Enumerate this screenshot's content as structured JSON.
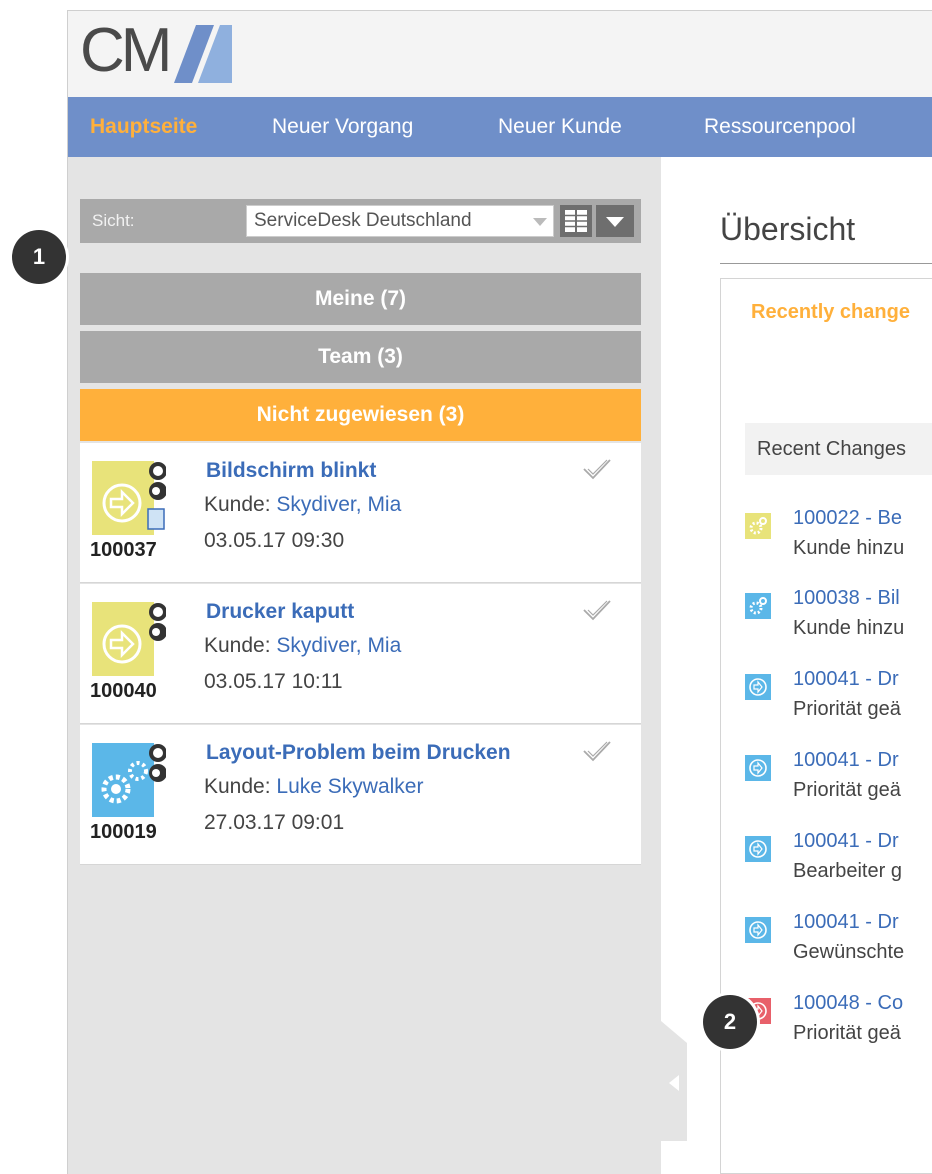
{
  "logo": {
    "text": "CM"
  },
  "nav": {
    "items": [
      "Hauptseite",
      "Neuer Vorgang",
      "Neuer Kunde",
      "Ressourcenpool"
    ],
    "active_index": 0
  },
  "sidebar": {
    "view_label": "Sicht:",
    "view_value": "ServiceDesk Deutschland",
    "groups": [
      "Meine (7)",
      "Team (3)",
      "Nicht zugewiesen (3)"
    ],
    "selected_group_index": 2,
    "tickets": [
      {
        "id": "100037",
        "title": "Bildschirm blinkt",
        "kunde_label": "Kunde:",
        "kunde": "Skydiver, Mia",
        "date": "03.05.17 09:30",
        "icon": "arrow-circle-icon",
        "color": "#e8e37a"
      },
      {
        "id": "100040",
        "title": "Drucker kaputt",
        "kunde_label": "Kunde:",
        "kunde": "Skydiver, Mia",
        "date": "03.05.17 10:11",
        "icon": "arrow-circle-icon",
        "color": "#e8e37a"
      },
      {
        "id": "100019",
        "title": "Layout-Problem beim Drucken",
        "kunde_label": "Kunde:",
        "kunde": "Luke Skywalker",
        "date": "27.03.17 09:01",
        "icon": "gears-icon",
        "color": "#5bb7e8"
      }
    ]
  },
  "main": {
    "title": "Übersicht",
    "panel_heading": "Recently change",
    "recent_bar": "Recent Changes",
    "recent_items": [
      {
        "line1": "100022 - Be",
        "line2": "Kunde hinzu",
        "icon": "gears-icon",
        "color": "#e8e37a"
      },
      {
        "line1": "100038 - Bil",
        "line2": "Kunde hinzu",
        "icon": "gears-icon",
        "color": "#5bb7e8"
      },
      {
        "line1": "100041 - Dr",
        "line2": "Priorität geä",
        "icon": "arrow-circle-icon",
        "color": "#5bb7e8"
      },
      {
        "line1": "100041 - Dr",
        "line2": "Priorität geä",
        "icon": "arrow-circle-icon",
        "color": "#5bb7e8"
      },
      {
        "line1": "100041 - Dr",
        "line2": "Bearbeiter g",
        "icon": "arrow-circle-icon",
        "color": "#5bb7e8"
      },
      {
        "line1": "100041 - Dr",
        "line2": "Gewünschte",
        "icon": "arrow-circle-icon",
        "color": "#5bb7e8"
      },
      {
        "line1": "100048 - Co",
        "line2": "Priorität geä",
        "icon": "arrow-circle-icon",
        "color": "#e8606a"
      }
    ]
  },
  "callouts": [
    "1",
    "2"
  ]
}
